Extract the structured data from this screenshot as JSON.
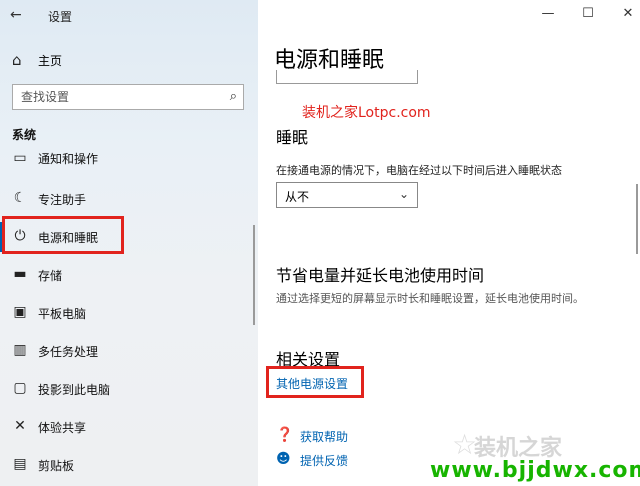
{
  "window": {
    "app_title": "设置",
    "controls": {
      "minimize": "—",
      "maximize": "☐",
      "close": "✕"
    }
  },
  "sidebar": {
    "home_label": "主页",
    "search_placeholder": "查找设置",
    "section_label": "系统",
    "items": [
      {
        "label": "通知和操作",
        "icon": "notification-icon"
      },
      {
        "label": "专注助手",
        "icon": "moon-icon"
      },
      {
        "label": "电源和睡眠",
        "icon": "power-icon",
        "selected": true
      },
      {
        "label": "存储",
        "icon": "storage-icon"
      },
      {
        "label": "平板电脑",
        "icon": "tablet-icon"
      },
      {
        "label": "多任务处理",
        "icon": "multitask-icon"
      },
      {
        "label": "投影到此电脑",
        "icon": "project-icon"
      },
      {
        "label": "体验共享",
        "icon": "share-icon"
      },
      {
        "label": "剪贴板",
        "icon": "clipboard-icon"
      }
    ]
  },
  "content": {
    "page_title": "电源和睡眠",
    "watermark_text": "装机之家Lotpc.com",
    "sleep_title": "睡眠",
    "sleep_desc": "在接通电源的情况下，电脑在经过以下时间后进入睡眠状态",
    "sleep_value": "从不",
    "save_title": "节省电量并延长电池使用时间",
    "save_desc": "通过选择更短的屏幕显示时长和睡眠设置，延长电池使用时间。",
    "related_title": "相关设置",
    "related_link": "其他电源设置",
    "help_label": "获取帮助",
    "feedback_label": "提供反馈"
  },
  "watermark": {
    "logo_text": "装机之家",
    "url": "www.bjjdwx.com"
  },
  "colors": {
    "accent": "#0063b1",
    "highlight": "#e1231d",
    "watermark_green": "#17b400"
  }
}
